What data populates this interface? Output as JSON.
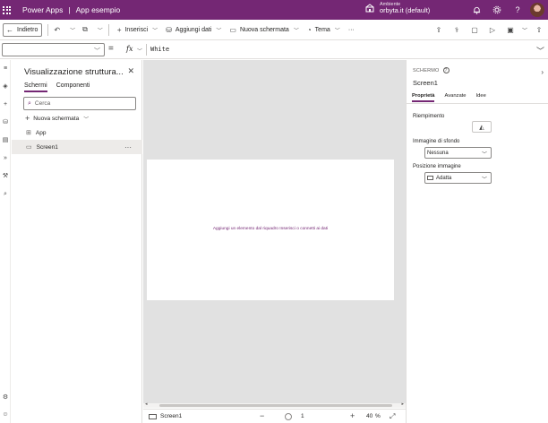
{
  "colors": {
    "brand": "#742774",
    "canvas_bg": "#e1e1e1",
    "panel_border": "#e1dfdd"
  },
  "header": {
    "app_name": "Power Apps",
    "separator": "|",
    "app_title": "App esempio",
    "environment_label": "Ambiente",
    "environment_value": "orbyta.it (default)",
    "icons": [
      "environment-icon",
      "bell-icon",
      "gear-icon",
      "help-icon",
      "avatar"
    ]
  },
  "commandbar": {
    "back_label": "Indietro",
    "insert_label": "Inserisci",
    "add_data_label": "Aggiungi dati",
    "new_screen_label": "Nuova schermata",
    "theme_label": "Tema",
    "more_label": "···"
  },
  "formula_bar": {
    "property": "",
    "equals": "=",
    "fx": "fx",
    "formula": "White"
  },
  "tree_view": {
    "title": "Visualizzazione struttura...",
    "tabs": [
      {
        "label": "Schermi",
        "active": true
      },
      {
        "label": "Componenti",
        "active": false
      }
    ],
    "search_placeholder": "Cerca",
    "new_screen_label": "Nuova schermata",
    "items": [
      {
        "label": "App",
        "icon": "app-icon"
      },
      {
        "label": "Screen1",
        "icon": "screen-icon",
        "selected": true,
        "more": "···"
      }
    ]
  },
  "canvas": {
    "hint": "Aggiungi un elemento dal riquadro Inserisci o connetti ai dati"
  },
  "statusbar": {
    "screen_name": "Screen1",
    "zoom_slider_value": "1",
    "zoom_value": "40",
    "zoom_unit": "%"
  },
  "properties": {
    "type_label": "SCHERMO",
    "name": "Screen1",
    "tabs": [
      {
        "label": "Proprietà",
        "active": true
      },
      {
        "label": "Avanzate",
        "active": false
      },
      {
        "label": "Idee",
        "active": false
      }
    ],
    "fill_label": "Riempimento",
    "background_image_label": "Immagine di sfondo",
    "background_image_value": "Nessuna",
    "image_position_label": "Posizione immagine",
    "image_position_value": "Adatta"
  }
}
